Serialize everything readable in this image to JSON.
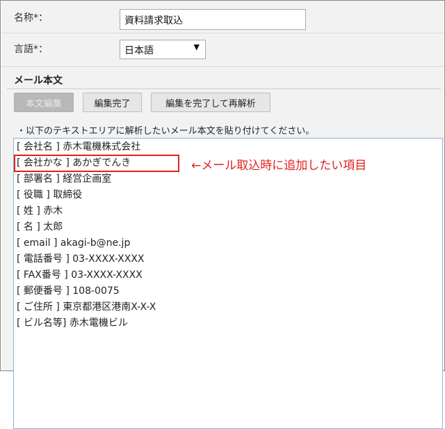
{
  "fields": {
    "name": {
      "label": "名称*：",
      "value": "資料請求取込"
    },
    "language": {
      "label": "言語*：",
      "selected": "日本語"
    }
  },
  "mail_body": {
    "title": "メール本文",
    "buttons": {
      "edit": "本文編集",
      "done": "編集完了",
      "done_reparse": "編集を完了して再解析"
    },
    "hint": "・以下のテキストエリアに解析したいメール本文を貼り付けてください。",
    "lines": [
      "[ 会社名 ] 赤木電機株式会社",
      "[ 会社かな ] あかぎでんき",
      "[ 部署名 ] 経営企画室",
      "[ 役職 ] 取締役",
      "[ 姓 ] 赤木",
      "[ 名 ] 太郎",
      "[ email ] akagi-b@ne.jp",
      "[ 電話番号 ] 03-XXXX-XXXX",
      "[ FAX番号 ] 03-XXXX-XXXX",
      "[ 郵便番号 ] 108-0075",
      "[ ご住所 ] 東京都港区港南X-X-X",
      "[ ビル名等] 赤木電機ビル"
    ],
    "annotation": "←メール取込時に追加したい項目"
  },
  "colors": {
    "annotation": "#e02020",
    "panel_bg": "#f2f2f2"
  }
}
